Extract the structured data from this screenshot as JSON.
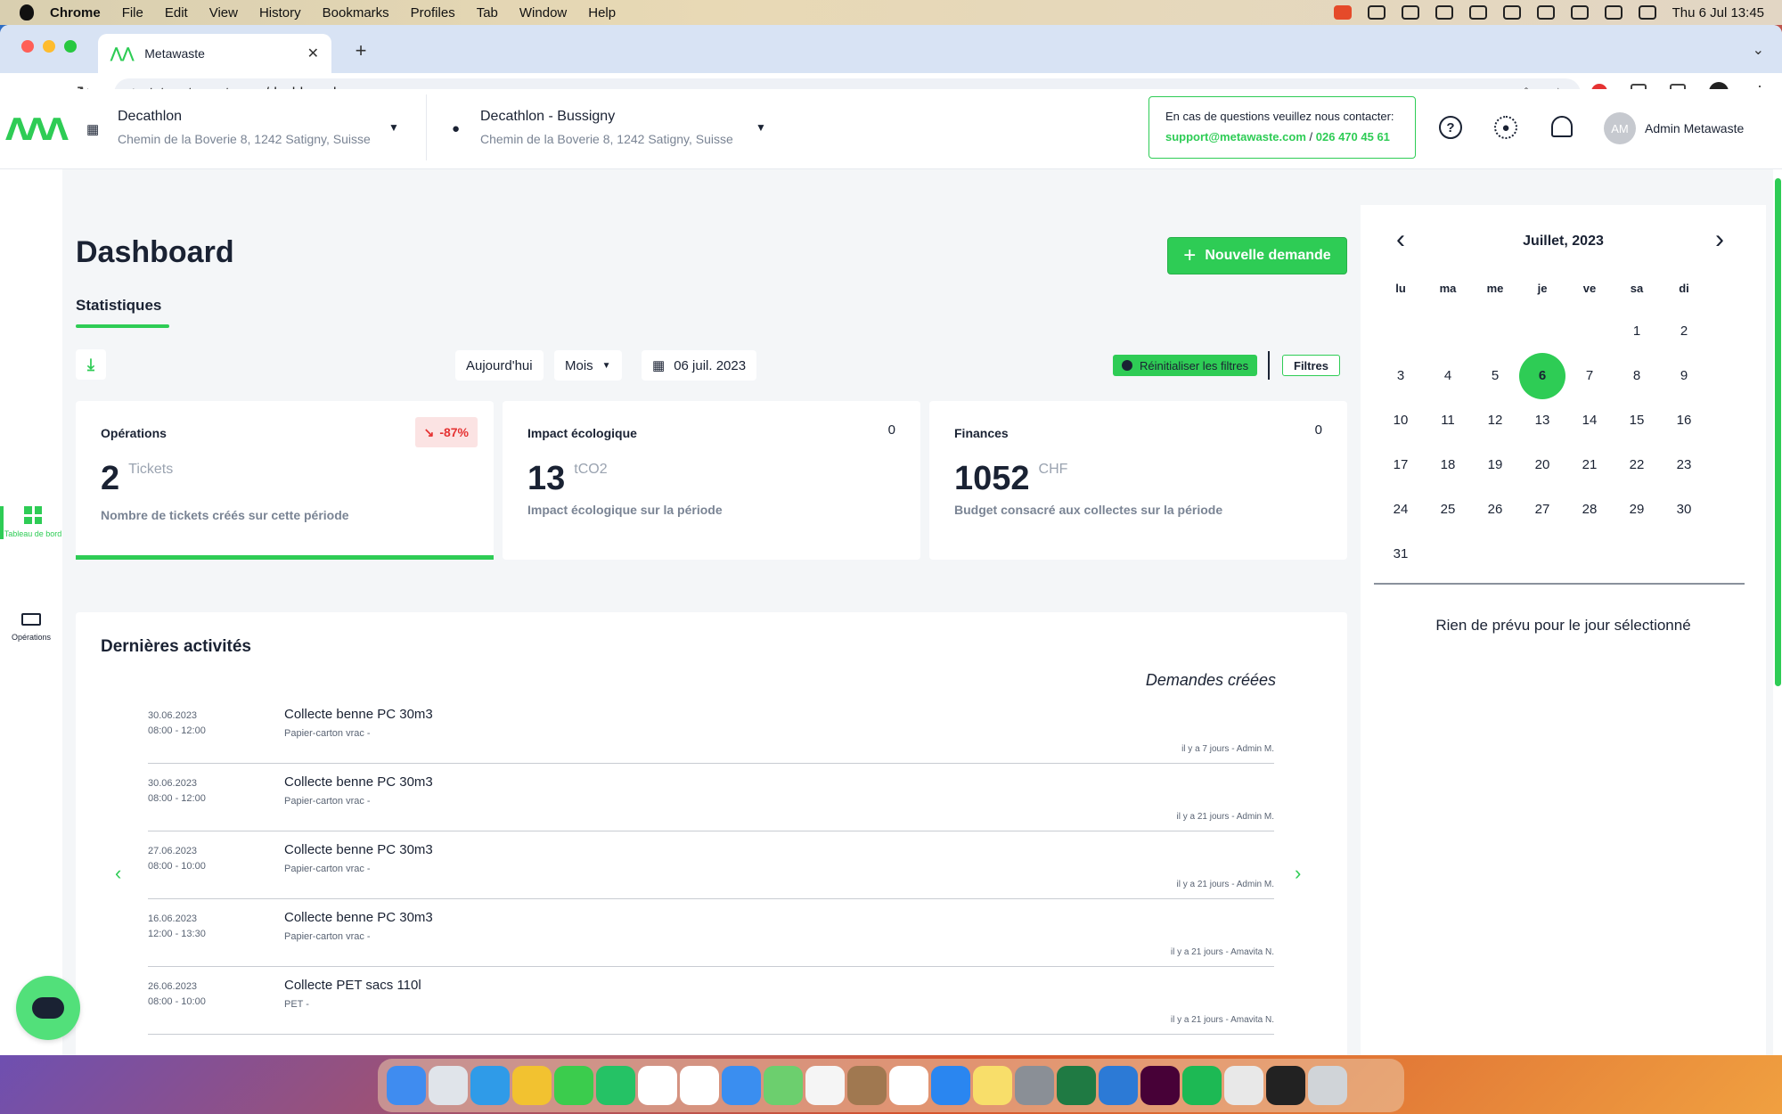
{
  "menubar": {
    "app": "Chrome",
    "items": [
      "File",
      "Edit",
      "View",
      "History",
      "Bookmarks",
      "Profiles",
      "Tab",
      "Window",
      "Help"
    ],
    "clock": "Thu 6 Jul  13:45"
  },
  "browser": {
    "tab_title": "Metawaste",
    "url": "tst.metawaste.app/dashboard"
  },
  "header": {
    "company": {
      "name": "Decathlon",
      "address": "Chemin de la Boverie 8, 1242 Satigny, Suisse"
    },
    "site": {
      "name": "Decathlon - Bussigny",
      "address": "Chemin de la Boverie 8, 1242 Satigny, Suisse"
    },
    "contact": {
      "line1": "En cas de questions veuillez nous contacter:",
      "email": "support@metawaste.com",
      "separator": "/",
      "phone": "026 470 45 61"
    },
    "user": {
      "initials": "AM",
      "name": "Admin Metawaste"
    }
  },
  "sidebar": {
    "items": [
      {
        "label": "Tableau de bord",
        "icon": "dashboard-grid-icon",
        "active": true
      },
      {
        "label": "Opérations",
        "icon": "truck-icon",
        "active": false
      }
    ]
  },
  "main": {
    "title": "Dashboard",
    "new_request": "Nouvelle demande",
    "tab": "Statistiques",
    "filters": {
      "today": "Aujourd'hui",
      "period": "Mois",
      "date": "06 juil. 2023",
      "reset": "Réinitialiser les filtres",
      "filters": "Filtres"
    },
    "cards": [
      {
        "title": "Opérations",
        "trend": "-87%",
        "value": "2",
        "unit": "Tickets",
        "desc": "Nombre de tickets créés sur cette période"
      },
      {
        "title": "Impact écologique",
        "count": "0",
        "value": "13",
        "unit": "tCO2",
        "desc": "Impact écologique sur la période"
      },
      {
        "title": "Finances",
        "count": "0",
        "value": "1052",
        "unit": "CHF",
        "desc": "Budget consacré aux collectes sur la période"
      }
    ],
    "activities": {
      "title": "Dernières activités",
      "subtitle": "Demandes créées",
      "rows": [
        {
          "date": "30.06.2023",
          "time": "08:00 - 12:00",
          "name": "Collecte benne PC 30m3",
          "sub": "Papier-carton vrac -",
          "meta": "il y a 7 jours - Admin M."
        },
        {
          "date": "30.06.2023",
          "time": "08:00 - 12:00",
          "name": "Collecte benne PC 30m3",
          "sub": "Papier-carton vrac -",
          "meta": "il y a 21 jours - Admin M."
        },
        {
          "date": "27.06.2023",
          "time": "08:00 - 10:00",
          "name": "Collecte benne PC 30m3",
          "sub": "Papier-carton vrac -",
          "meta": "il y a 21 jours - Admin M."
        },
        {
          "date": "16.06.2023",
          "time": "12:00 - 13:30",
          "name": "Collecte benne PC 30m3",
          "sub": "Papier-carton vrac -",
          "meta": "il y a 21 jours - Amavita N."
        },
        {
          "date": "26.06.2023",
          "time": "08:00 - 10:00",
          "name": "Collecte PET sacs 110l",
          "sub": "PET -",
          "meta": "il y a 21 jours - Amavita N."
        }
      ]
    }
  },
  "calendar": {
    "title": "Juillet, 2023",
    "weekdays": [
      "lu",
      "ma",
      "me",
      "je",
      "ve",
      "sa",
      "di"
    ],
    "first_weekday_index": 5,
    "days_in_month": 31,
    "selected_day": 6,
    "empty_message": "Rien de prévu pour le jour sélectionné"
  },
  "colors": {
    "accent": "#2ecc55",
    "text": "#1a2233",
    "negative": "#e53232"
  }
}
